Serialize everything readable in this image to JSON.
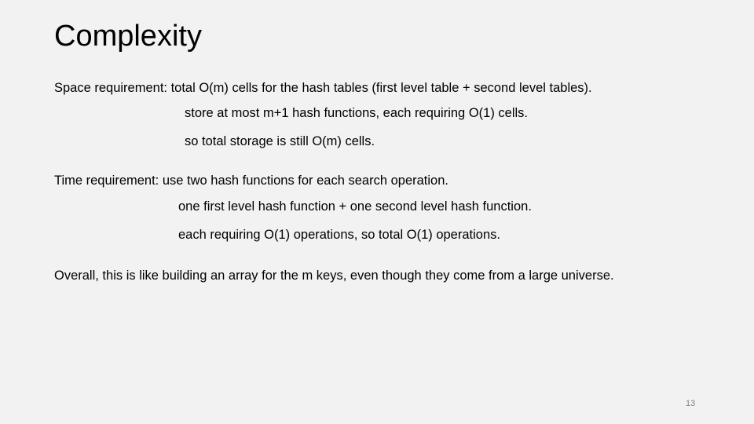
{
  "slide": {
    "title": "Complexity",
    "space": {
      "heading": "Space requirement: total O(m) cells for the hash tables (first level table + second level tables).",
      "details": [
        "store at most m+1 hash functions, each requiring O(1) cells.",
        "so total storage is still O(m) cells."
      ]
    },
    "time": {
      "heading": "Time requirement: use two hash functions for each search operation.",
      "details": [
        "one first level hash function + one second level hash function.",
        "each requiring O(1) operations, so total O(1) operations."
      ]
    },
    "overall": "Overall, this is like building an array for the m keys, even though they come from a large universe.",
    "page_number": "13"
  },
  "colors": {
    "background": "#f2f2f2",
    "text": "#000000",
    "page_number": "#808080"
  }
}
